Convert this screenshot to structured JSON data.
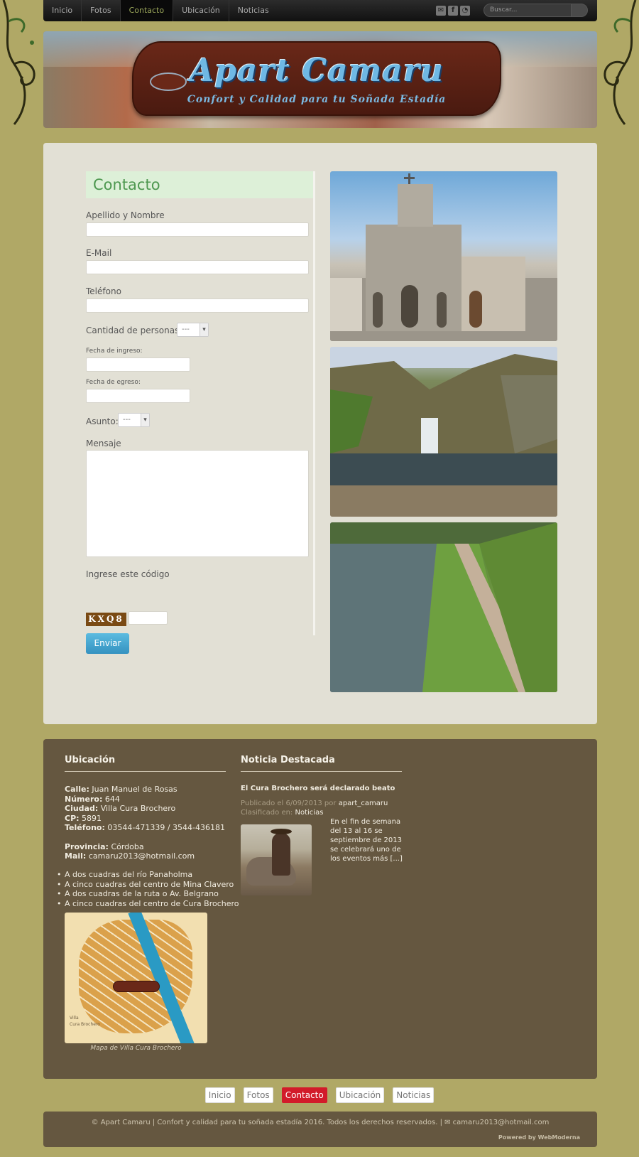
{
  "nav": {
    "items": [
      {
        "label": "Inicio",
        "active": false
      },
      {
        "label": "Fotos",
        "active": false
      },
      {
        "label": "Contacto",
        "active": true
      },
      {
        "label": "Ubicación",
        "active": false
      },
      {
        "label": "Noticias",
        "active": false
      }
    ],
    "search_placeholder": "Buscar...",
    "social_icons": [
      "email-icon",
      "facebook-icon",
      "rss-icon"
    ]
  },
  "banner": {
    "brand": "Apart Camaru",
    "slogan": "Confort y Calidad para tu Soñada Estadía"
  },
  "contact": {
    "title": "Contacto",
    "name_label": "Apellido y Nombre",
    "email_label": "E-Mail",
    "phone_label": "Teléfono",
    "people_label": "Cantidad de personas:",
    "people_value": "---",
    "checkin_label": "Fecha de ingreso:",
    "checkout_label": "Fecha de egreso:",
    "subject_label": "Asunto:",
    "subject_value": "---",
    "message_label": "Mensaje",
    "captcha_label": "Ingrese este código",
    "captcha_code": "KXQ8",
    "submit_label": "Enviar"
  },
  "location": {
    "title": "Ubicación",
    "street_label": "Calle:",
    "street": "Juan Manuel de Rosas",
    "number_label": "Número:",
    "number": "644",
    "city_label": "Ciudad:",
    "city": "Villa Cura Brochero",
    "cp_label": "CP:",
    "cp": "5891",
    "phone_label": "Teléfono:",
    "phone": "03544-471339 / 3544-436181",
    "province_label": "Provincia:",
    "province": "Córdoba",
    "mail_label": "Mail:",
    "mail": "camaru2013@hotmail.com",
    "bullets": [
      "A dos cuadras del río Panaholma",
      "A cinco cuadras del centro de Mina Clavero",
      "A dos cuadras de la ruta o Av. Belgrano",
      "A cinco cuadras del centro de Cura Brochero"
    ],
    "map_town": "Villa\nCura Brochero",
    "map_caption": "Mapa de Villa Cura Brochero"
  },
  "news": {
    "title": "Noticia Destacada",
    "headline": "El Cura Brochero será declarado beato",
    "published_prefix": "Publicado el 6/09/2013 por",
    "author": "apart_camaru",
    "category_prefix": "Clasificado en:",
    "category": "Noticias",
    "excerpt": "En el fin de semana del 13 al 16 se septiembre de 2013 se celebrará uno de los eventos más [...]"
  },
  "footer_nav": [
    {
      "label": "Inicio",
      "active": false
    },
    {
      "label": "Fotos",
      "active": false
    },
    {
      "label": "Contacto",
      "active": true
    },
    {
      "label": "Ubicación",
      "active": false
    },
    {
      "label": "Noticias",
      "active": false
    }
  ],
  "copyright": "© Apart Camaru | Confort y calidad para tu soñada estadía 2016. Todos los derechos reservados. | ✉ camaru2013@hotmail.com",
  "powered_by": "Powered by WebModerna",
  "colors": {
    "background": "#b0a866",
    "accent_green": "#4e9850",
    "button_blue": "#3592c0",
    "active_red": "#d21b2a",
    "footer_brown": "#655740"
  }
}
